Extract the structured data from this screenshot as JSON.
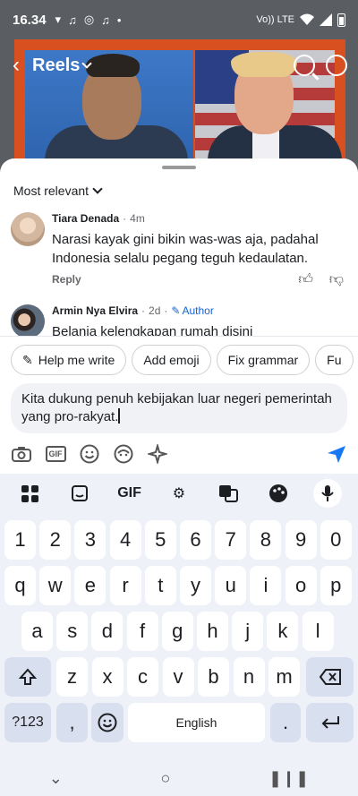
{
  "status_bar": {
    "time": "16.34",
    "network_label": "Vo)) LTE"
  },
  "reels": {
    "title": "Reels"
  },
  "comments": {
    "sort_label": "Most relevant",
    "items": [
      {
        "name": "Tiara Denada",
        "time": "4m",
        "text": "Narasi kayak gini bikin was-was aja, padahal Indonesia selalu pegang teguh kedaulatan.",
        "reply_label": "Reply"
      },
      {
        "name": "Armin Nya Elvira",
        "time": "2d",
        "author_label": "Author",
        "text": "Belanja kelengkapan rumah disini"
      }
    ]
  },
  "chips": [
    "Help me write",
    "Add emoji",
    "Fix grammar",
    "Fu"
  ],
  "composer": {
    "text": "Kita dukung penuh kebijakan luar negeri pemerintah yang pro-rakyat."
  },
  "keyboard": {
    "toolbar_gif": "GIF",
    "rows": [
      [
        "1",
        "2",
        "3",
        "4",
        "5",
        "6",
        "7",
        "8",
        "9",
        "0"
      ],
      [
        "q",
        "w",
        "e",
        "r",
        "t",
        "y",
        "u",
        "i",
        "o",
        "p"
      ],
      [
        "a",
        "s",
        "d",
        "f",
        "g",
        "h",
        "j",
        "k",
        "l"
      ],
      [
        "z",
        "x",
        "c",
        "v",
        "b",
        "n",
        "m"
      ]
    ],
    "symbols_label": "?123",
    "comma": ",",
    "space_label": "English",
    "period": "."
  },
  "colors": {
    "accent": "#1763cf",
    "send": "#1877f2",
    "keyboard_bg": "#eef1f7",
    "function_key": "#d8dfee"
  }
}
